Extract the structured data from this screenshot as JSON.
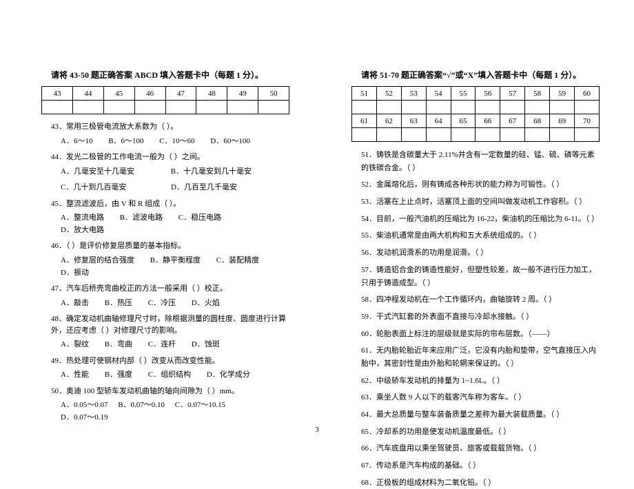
{
  "pageNumber": "3",
  "left": {
    "header": "请将 43-50 题正确答案 ABCD 填入答题卡中（每题 1 分）。",
    "gridCells": [
      "43",
      "44",
      "45",
      "46",
      "47",
      "48",
      "49",
      "50"
    ],
    "q43": "43．常用三极管电流放大系数为（    ）。",
    "q43opts": [
      "A．6～10",
      "B．6～100",
      "C．10～60",
      "D．60～100"
    ],
    "q44": "44．发光二极管的工作电流一般为（    ）之间。",
    "q44optsA": "A．几毫安至十几毫安",
    "q44optsB": "B．十几毫安到几十毫安",
    "q44optsC": "C．几十到几百毫安",
    "q44optsD": "D．几百至几千毫安",
    "q45": "45．整流滤波后，由 V 和 R 组成（    ）。",
    "q45opts": [
      "A．整流电路",
      "B．滤波电路",
      "C．稳压电路",
      "D．放大电路"
    ],
    "q46": "46．（    ）是评价修复层质量的基本指标。",
    "q46opts": [
      "A．修复层的结合强度",
      "B．静平衡程度",
      "C．装配精度",
      "D．振动"
    ],
    "q47": "47．汽车后桥壳弯曲校正的方法一般采用（    ）校正。",
    "q47opts": [
      "A．敲击",
      "B．热压",
      "C．冷压",
      "D．火焰"
    ],
    "q48": "48．确定发动机曲轴修理尺寸时，除根据测量的圆柱度、圆度进行计算外，还应考虑（    ）对修理尺寸的影响。",
    "q48opts": [
      "A．裂纹",
      "B．弯曲",
      "C．连杆",
      "D．蚀斑"
    ],
    "q49": "49．热处理可使钢材内部（    ）改变从而改变性能。",
    "q49opts": [
      "A．性能",
      "B．强度",
      "C．组织结构",
      "D．化学成分"
    ],
    "q50": "50．奥迪 100 型轿车发动机曲轴的轴向间隙为（    ）mm。",
    "q50opts": [
      "A．0.05～0.07",
      "B．0.07～0.10",
      "C．0.07～10.15",
      "D．0.07～0.19"
    ]
  },
  "right": {
    "header": "请将 51-70 题正确答案“√”或“X”填入答题卡中（每题 1 分）。",
    "gridRow1": [
      "51",
      "52",
      "53",
      "54",
      "55",
      "56",
      "57",
      "58",
      "59",
      "60"
    ],
    "gridRow2": [
      "61",
      "62",
      "63",
      "64",
      "65",
      "66",
      "67",
      "68",
      "69",
      "70"
    ],
    "q51": "51．铸铁是含碳量大于 2.11%并含有一定数量的硅、锰、硫、磷等元素的铁碳合金。（    ）",
    "q52": "52．金属熔化后，则有铸成各种形状的能力称为可锻性。（    ）",
    "q53": "53．活塞在上止点时，活塞顶上面的空间叫做发动机工作容积。（    ）",
    "q54": "54．目前，一般汽油机的压缩比为 16-22，柴油机的压缩比为 6-11。（    ）",
    "q55": "55．柴油机通常是由两大机构和五大系统组成的。（    ）",
    "q56": "56．发动机润滑系的功用是润滑。（    ）",
    "q57": "57．铸造铝合金的铸造性能好，但塑性较差，故一般不进行压力加工，只用于铸造成型。（    ）",
    "q58": "58．四冲程发动机在一个工作循环内，曲轴旋转 2 周。（    ）",
    "q59": "59．干式汽缸套的外表面不直接与冷却水接触。（    ）",
    "q60": "60．轮胎表面上标注的层级就是实际的帘布层数。（——）",
    "q61": "61．无内胎轮胎近年来应用广泛，它没有内胎和垫带，空气直接压入内胎中，其密封性是由外胎和轮辋来保证的。（    ）",
    "q62": "62．中级轿车发动机的排量为 1~1.6L。（    ）",
    "q63": "63．乘坐人数 9 人以下的载客汽车称为客车。（    ）",
    "q64": "64．最大总质量与整车装备质量之差称为最大装载质量。（    ）",
    "q65": "65．冷却系的功用是使发动机温度最低。（    ）",
    "q66": "66．汽车底盘用以乘坐驾驶员、旅客或载载货物。（    ）",
    "q67": "67．传动系是汽车构成的基础。（    ）",
    "q68": "68．正极板的组成材料为二氧化铅。（    ）"
  }
}
